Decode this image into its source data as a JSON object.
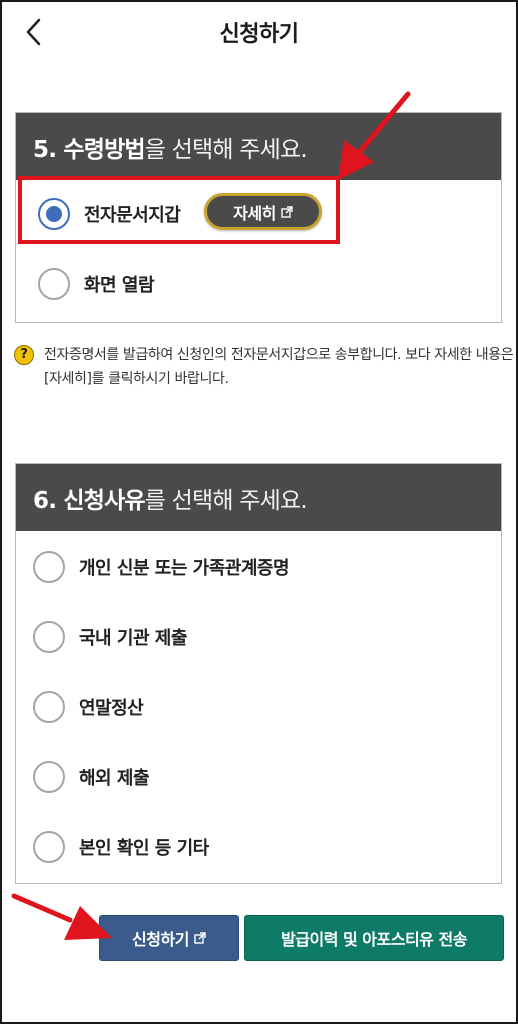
{
  "header": {
    "title": "신청하기",
    "back_icon": "chevron-left-icon"
  },
  "section5": {
    "title_strong": "5. 수령방법",
    "title_rest": "을 선택해 주세요.",
    "options": [
      {
        "label": "전자문서지갑",
        "selected": true
      },
      {
        "label": "화면 열람",
        "selected": false
      }
    ],
    "detail_button": "자세히",
    "detail_icon": "external-link-icon"
  },
  "help": {
    "icon": "question-icon",
    "text": "전자증명서를 발급하여 신청인의 전자문서지갑으로 송부합니다. 보다 자세한 내용은 [자세히]를 클릭하시기 바랍니다."
  },
  "section6": {
    "title_strong": "6. 신청사유",
    "title_rest": "를 선택해 주세요.",
    "options": [
      {
        "label": "개인 신분 또는 가족관계증명",
        "selected": false
      },
      {
        "label": "국내 기관 제출",
        "selected": false
      },
      {
        "label": "연말정산",
        "selected": false
      },
      {
        "label": "해외 제출",
        "selected": false
      },
      {
        "label": "본인 확인 등 기타",
        "selected": false
      }
    ]
  },
  "buttons": {
    "apply": "신청하기",
    "apply_icon": "external-link-icon",
    "send": "발급이력 및 아포스티유 전송"
  },
  "colors": {
    "section_header": "#4a4a4a",
    "radio_selected": "#3d6dbb",
    "highlight_red": "#e0141e",
    "apply_button": "#3b5b8c",
    "send_button": "#0e7b67",
    "detail_border": "#c9a431"
  }
}
